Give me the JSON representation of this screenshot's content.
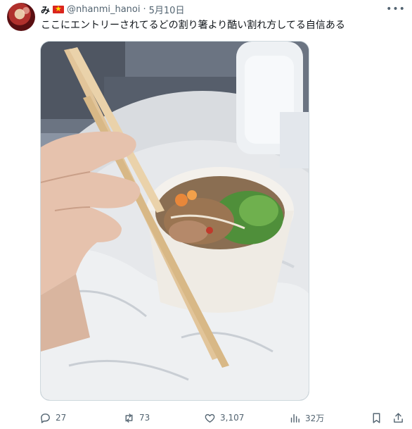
{
  "tweet": {
    "display_name": "み",
    "flag": "flag-vietnam",
    "handle": "@nhanmi_hanoi",
    "separator": "·",
    "date": "5月10日",
    "more_icon": "more-horizontal-icon",
    "text": "ここにエントリーされてるどの割り箸より酷い割れ方してる自信ある",
    "media": "photo of a paper bowl of noodle salad held by a hand with badly split wooden chopsticks"
  },
  "actions": {
    "reply_count": "27",
    "retweet_count": "73",
    "like_count": "3,107",
    "views_count": "32万"
  },
  "colors": {
    "text": "#0f1419",
    "secondary": "#536471",
    "border": "#cfd9de"
  }
}
